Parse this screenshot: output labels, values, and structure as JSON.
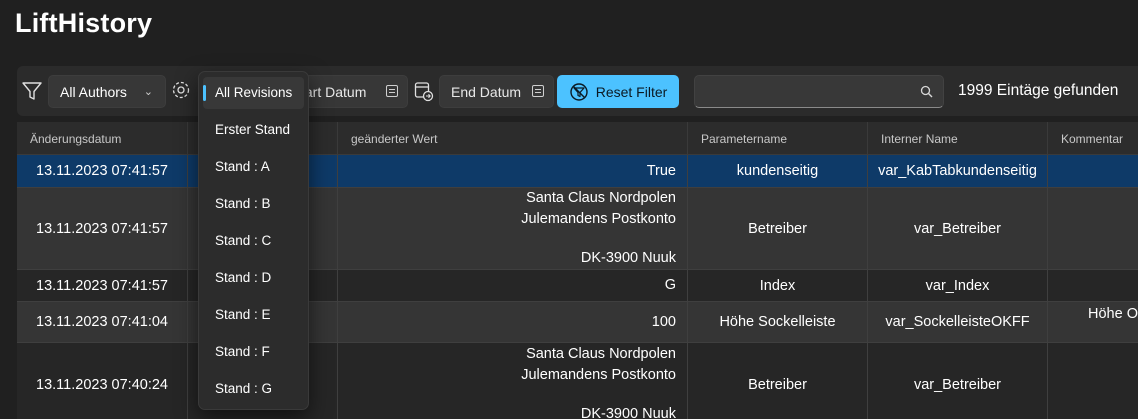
{
  "app": {
    "title": "LiftHistory"
  },
  "toolbar": {
    "authors_label": "All Authors",
    "start_date_label": "tart Datum",
    "end_date_label": "End Datum",
    "reset_label": "Reset Filter",
    "search_value": "",
    "count_text": "1999 Eintäge gefunden",
    "accent_color": "#4cc2ff"
  },
  "revisions": {
    "selected": "All Revisions",
    "options": [
      "All Revisions",
      "Erster Stand",
      "Stand : A",
      "Stand : B",
      "Stand : C",
      "Stand : D",
      "Stand : E",
      "Stand : F",
      "Stand : G"
    ]
  },
  "table": {
    "headers": [
      "Änderungsdatum",
      "",
      "geänderter Wert",
      "Parametername",
      "Interner Name",
      "Kommentar"
    ],
    "rows": [
      {
        "date": "13.11.2023 07:41:57",
        "value_lines": [
          "True"
        ],
        "param": "kundenseitig",
        "internal": "var_KabTabkundenseitig",
        "comment": ""
      },
      {
        "date": "13.11.2023 07:41:57",
        "value_lines": [
          "Santa Claus Nordpolen",
          "Julemandens Postkonto",
          "",
          "DK-3900 Nuuk"
        ],
        "param": "Betreiber",
        "internal": "var_Betreiber",
        "comment": ""
      },
      {
        "date": "13.11.2023 07:41:57",
        "value_lines": [
          "G"
        ],
        "param": "Index",
        "internal": "var_Index",
        "comment": ""
      },
      {
        "date": "13.11.2023 07:41:04",
        "value_lines": [
          "100"
        ],
        "param": "Höhe Sockelleiste",
        "internal": "var_SockelleisteOKFF",
        "comment": "Höhe O"
      },
      {
        "date": "13.11.2023 07:40:24",
        "value_lines": [
          "Santa Claus Nordpolen",
          "Julemandens Postkonto",
          "",
          "DK-3900 Nuuk"
        ],
        "param": "Betreiber",
        "internal": "var_Betreiber",
        "comment": ""
      }
    ]
  }
}
